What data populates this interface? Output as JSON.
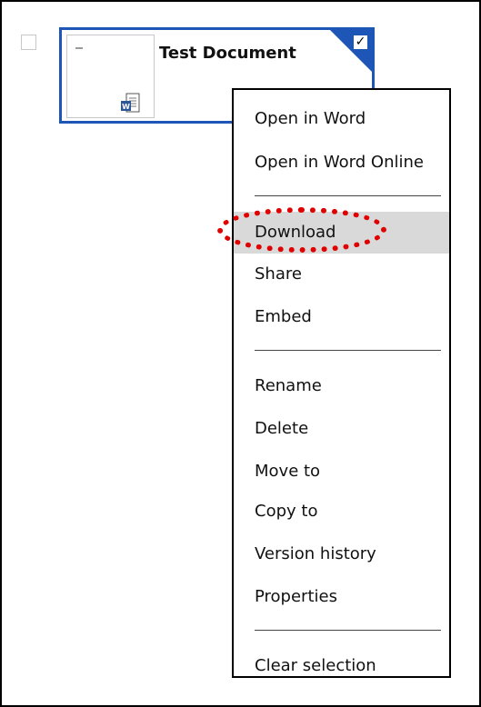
{
  "tile": {
    "title": "Test Document",
    "selected": true,
    "file_type_icon": "word-document-icon",
    "check_mark": "✓"
  },
  "menu": {
    "items": [
      {
        "label": "Open in Word"
      },
      {
        "label": "Open in Word Online"
      },
      {
        "label": "Download",
        "highlighted": true
      },
      {
        "label": "Share"
      },
      {
        "label": "Embed"
      },
      {
        "label": "Rename"
      },
      {
        "label": "Delete"
      },
      {
        "label": "Move to"
      },
      {
        "label": "Copy to"
      },
      {
        "label": "Version history"
      },
      {
        "label": "Properties"
      },
      {
        "label": "Clear selection"
      }
    ]
  },
  "colors": {
    "selection_blue": "#1e56b8",
    "hover_gray": "#d9d9d9",
    "annotation_red": "#e00000"
  }
}
